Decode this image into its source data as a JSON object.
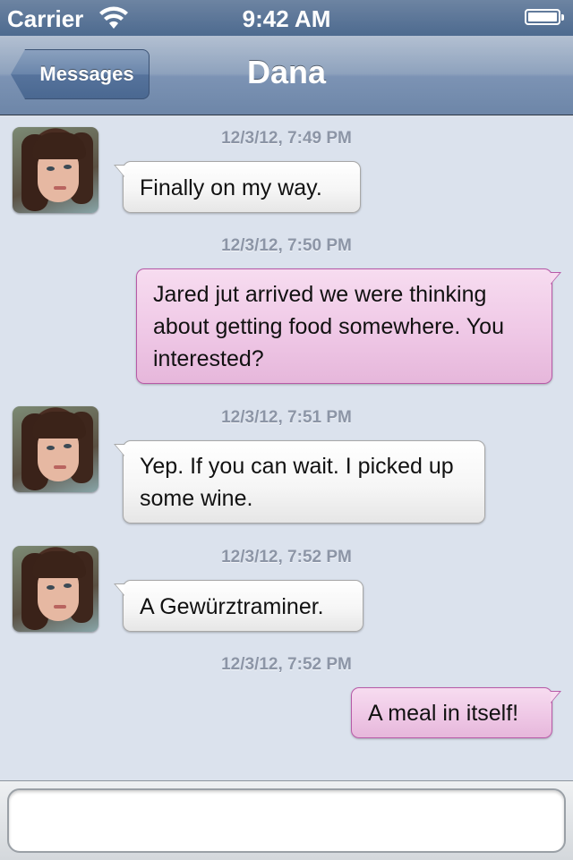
{
  "status_bar": {
    "carrier": "Carrier",
    "time": "9:42 AM",
    "wifi_icon": "wifi-icon",
    "battery_icon": "battery-icon",
    "battery_level": 1.0
  },
  "nav": {
    "back_label": "Messages",
    "title": "Dana"
  },
  "messages": [
    {
      "timestamp": "12/3/12, 7:49 PM",
      "direction": "incoming",
      "text": "Finally on my way."
    },
    {
      "timestamp": "12/3/12, 7:50 PM",
      "direction": "outgoing",
      "text": "Jared jut arrived we were thinking about getting food somewhere. You interested?"
    },
    {
      "timestamp": "12/3/12, 7:51 PM",
      "direction": "incoming",
      "text": "Yep. If you can wait. I picked up some wine."
    },
    {
      "timestamp": "12/3/12, 7:52 PM",
      "direction": "incoming",
      "text": "A Gewürztraminer."
    },
    {
      "timestamp": "12/3/12, 7:52 PM",
      "direction": "outgoing",
      "text": "A meal in itself!"
    }
  ],
  "colors": {
    "incoming_bubble": "#ffffff",
    "outgoing_bubble": "#efc8e6",
    "background": "#dbe2ed",
    "nav_bar": "#8ea2bd"
  }
}
